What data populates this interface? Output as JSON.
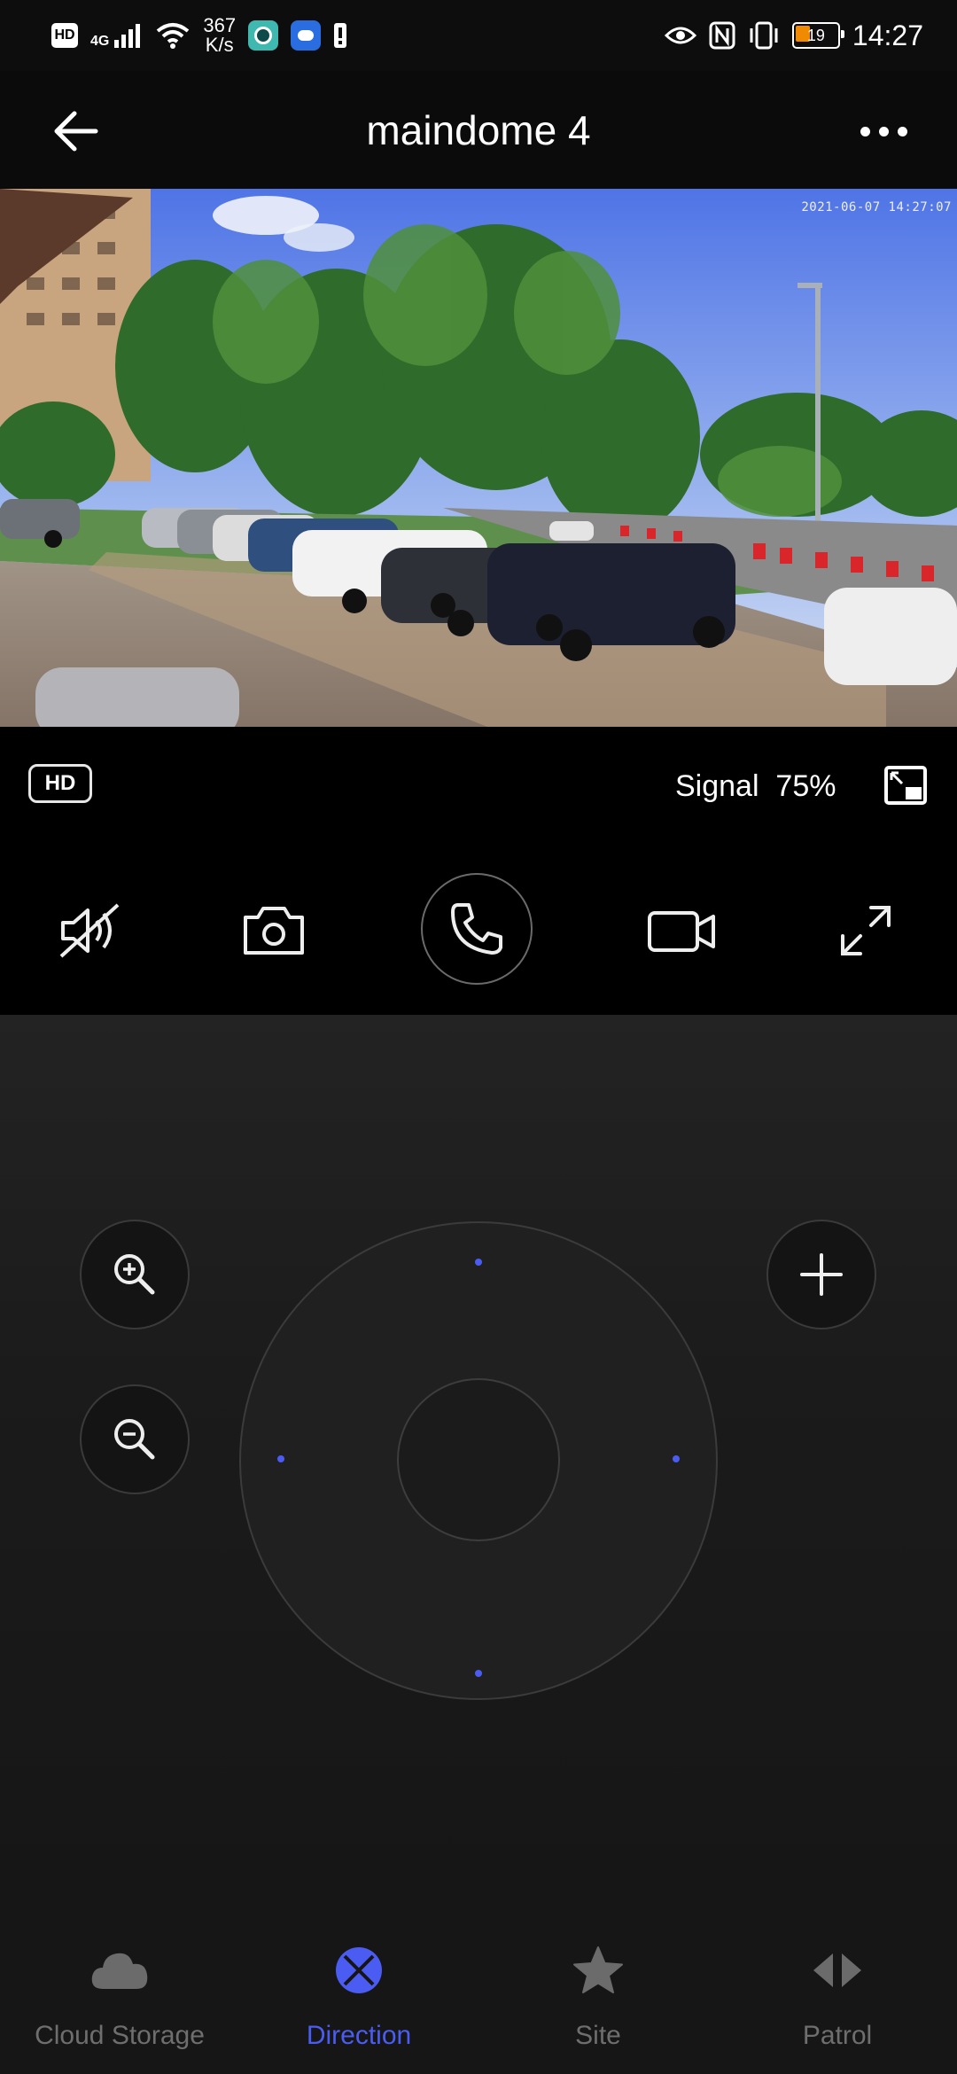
{
  "status_bar": {
    "hd_badge": "HD",
    "network": "4G",
    "speed_value": "367",
    "speed_unit": "K/s",
    "battery": "19",
    "time": "14:27"
  },
  "header": {
    "title": "maindome 4"
  },
  "video": {
    "timestamp": "2021-06-07  14:27:07"
  },
  "info": {
    "quality_badge": "HD",
    "signal_label": "Signal",
    "signal_value": "75%"
  },
  "colors": {
    "accent": "#4b5cf2",
    "inactive": "#6e6e6e",
    "battery": "#f08a00"
  },
  "bottom_nav": {
    "items": [
      {
        "label": "Cloud Storage",
        "icon": "cloud-icon",
        "active": false
      },
      {
        "label": "Direction",
        "icon": "direction-icon",
        "active": true
      },
      {
        "label": "Site",
        "icon": "star-icon",
        "active": false
      },
      {
        "label": "Patrol",
        "icon": "patrol-icon",
        "active": false
      }
    ]
  }
}
